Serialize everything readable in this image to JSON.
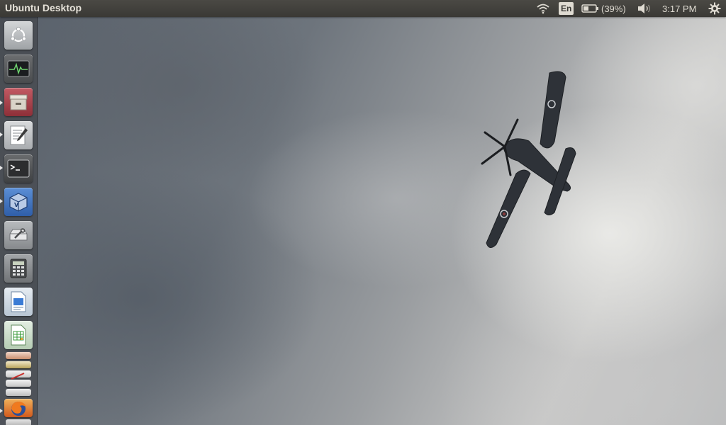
{
  "top_panel": {
    "title": "Ubuntu Desktop",
    "keyboard_layout": "En",
    "battery_percent": "(39%)",
    "clock": "3:17 PM",
    "icons": [
      "wifi-icon",
      "battery-icon",
      "volume-icon",
      "system-gear-icon"
    ]
  },
  "launcher": {
    "items": [
      {
        "name": "ubuntu-dash",
        "running": false
      },
      {
        "name": "system-monitor",
        "running": false
      },
      {
        "name": "archive-manager",
        "running": true
      },
      {
        "name": "text-editor",
        "running": true
      },
      {
        "name": "terminal",
        "running": true
      },
      {
        "name": "virtualbox",
        "running": true
      },
      {
        "name": "disk-utility",
        "running": false
      },
      {
        "name": "calculator",
        "running": false
      },
      {
        "name": "libreoffice-writer",
        "running": false
      },
      {
        "name": "libreoffice-calc",
        "running": false
      },
      {
        "name": "firefox",
        "running": true
      }
    ],
    "colors": {
      "dash": "#b9bcbf",
      "system_monitor": "#5f6163",
      "archive_manager": "#a8404a",
      "text_editor": "#bfc2c4",
      "terminal": "#545658",
      "virtualbox": "#3d6fb8",
      "disk_utility": "#9a9da0",
      "calculator": "#8f9295",
      "writer": "#cfd8e2",
      "calc": "#c9dac7"
    }
  },
  "desktop": {
    "wallpaper": "cloudy-sky-with-airplane"
  }
}
